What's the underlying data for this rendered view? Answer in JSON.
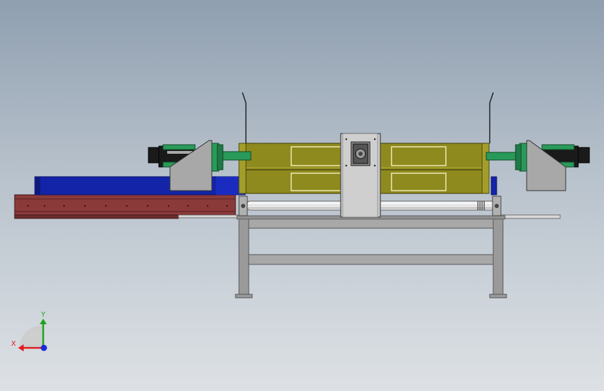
{
  "viewport": {
    "background_top": "#8f9fb0",
    "background_bottom": "#dde1e5"
  },
  "colors": {
    "frame_gray": "#9a9a9a",
    "frame_dark": "#555555",
    "olive_housing": "#8f8a1e",
    "olive_dark": "#4d4a10",
    "blue_rail": "#1424a8",
    "blue_dark": "#0a1260",
    "rail_brown": "#8b3a3a",
    "brown_dark": "#3d1a1a",
    "cylinder_green": "#2a9a5a",
    "cylinder_black": "#1a1a1a",
    "plate_gray": "#c8c8c8",
    "shaft_light": "#e6e6e6"
  },
  "triad": {
    "x_label": "X",
    "y_label": "Y",
    "x_color": "#e21b1b",
    "y_color": "#1ea31e",
    "z_color": "#1a2cd6"
  }
}
